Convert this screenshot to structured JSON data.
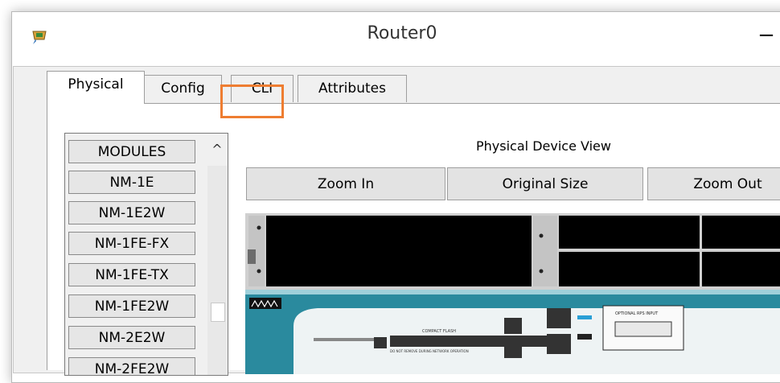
{
  "window": {
    "title": "Router0",
    "minimize_label": "−"
  },
  "tabs": [
    {
      "label": "Physical",
      "active": true
    },
    {
      "label": "Config"
    },
    {
      "label": "CLI",
      "highlighted": true
    },
    {
      "label": "Attributes"
    }
  ],
  "modules": {
    "items": [
      "MODULES",
      "NM-1E",
      "NM-1E2W",
      "NM-1FE-FX",
      "NM-1FE-TX",
      "NM-1FE2W",
      "NM-2E2W",
      "NM-2FE2W"
    ]
  },
  "device_view": {
    "title": "Physical Device View",
    "zoom_in": "Zoom In",
    "original_size": "Original Size",
    "zoom_out": "Zoom Out",
    "chassis_labels": {
      "compact_flash": "COMPACT FLASH",
      "warning": "DO NOT REMOVE DURING NETWORK OPERATION",
      "rps": "OPTIONAL RPS INPUT"
    }
  },
  "colors": {
    "highlight": "#ee7d31",
    "chassis_teal": "#2a8a9e"
  }
}
